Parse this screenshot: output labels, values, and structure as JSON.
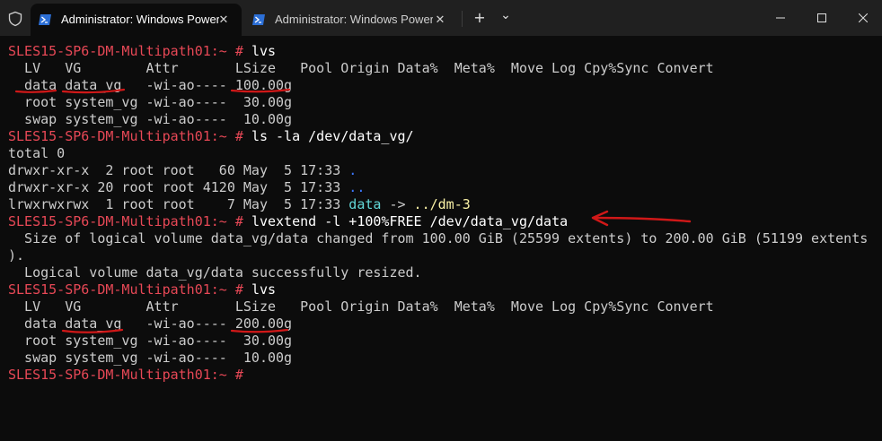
{
  "window": {
    "tabs": [
      {
        "title": "Administrator: Windows PowerShell",
        "active": true,
        "close": "✕"
      },
      {
        "title": "Administrator: Windows PowerShell",
        "active": false,
        "close": "✕"
      }
    ],
    "new_tab": "+",
    "dropdown": "⌄"
  },
  "colors": {
    "prompt": "#e74856",
    "background": "#0c0c0c",
    "text": "#cccccc",
    "annotation": "#d01818"
  },
  "terminal": {
    "lines": [
      {
        "prompt": "SLES15-SP6-DM-Multipath01:~ # ",
        "command": "lvs"
      },
      {
        "text": "  LV   VG        Attr       LSize   Pool Origin Data%  Meta%  Move Log Cpy%Sync Convert"
      },
      {
        "text": "  data data_vg   -wi-ao---- 100.00g"
      },
      {
        "text": "  root system_vg -wi-ao----  30.00g"
      },
      {
        "text": "  swap system_vg -wi-ao----  10.00g"
      },
      {
        "prompt": "SLES15-SP6-DM-Multipath01:~ # ",
        "command": "ls -la /dev/data_vg/"
      },
      {
        "text": "total 0"
      },
      {
        "text": "drwxr-xr-x  2 root root   60 May  5 17:33 ",
        "name": "."
      },
      {
        "text": "drwxr-xr-x 20 root root 4120 May  5 17:33 ",
        "name": ".."
      },
      {
        "text": "lrwxrwxrwx  1 root root    7 May  5 17:33 ",
        "name": "data",
        "arrow": " -> ",
        "target": "../dm-3"
      },
      {
        "prompt": "SLES15-SP6-DM-Multipath01:~ # ",
        "command": "lvextend -l +100%FREE /dev/data_vg/data"
      },
      {
        "text": "  Size of logical volume data_vg/data changed from 100.00 GiB (25599 extents) to 200.00 GiB (51199 extents"
      },
      {
        "text": ")."
      },
      {
        "text": "  Logical volume data_vg/data successfully resized."
      },
      {
        "prompt": "SLES15-SP6-DM-Multipath01:~ # ",
        "command": "lvs"
      },
      {
        "text": "  LV   VG        Attr       LSize   Pool Origin Data%  Meta%  Move Log Cpy%Sync Convert"
      },
      {
        "text": "  data data_vg   -wi-ao---- 200.00g"
      },
      {
        "text": "  root system_vg -wi-ao----  30.00g"
      },
      {
        "text": "  swap system_vg -wi-ao----  10.00g"
      },
      {
        "prompt": "SLES15-SP6-DM-Multipath01:~ # ",
        "command": ""
      }
    ]
  }
}
